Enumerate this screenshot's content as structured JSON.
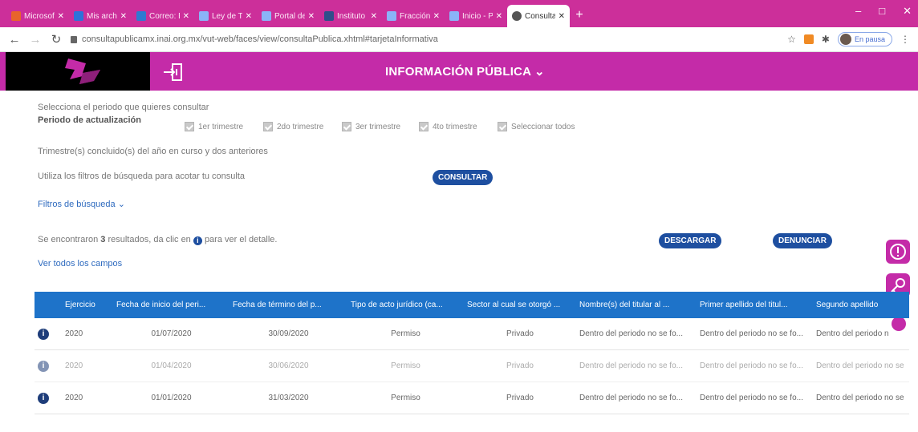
{
  "browser": {
    "tabs": [
      {
        "title": "Microsoft",
        "color": "#e8642c"
      },
      {
        "title": "Mis archivos",
        "color": "#2d72d9"
      },
      {
        "title": "Correo: Ed",
        "color": "#2f7ad1"
      },
      {
        "title": "Ley de Tra",
        "color": "#8ab4f8"
      },
      {
        "title": "Portal de T",
        "color": "#8ab4f8"
      },
      {
        "title": "Instituto d",
        "color": "#2f4f8a"
      },
      {
        "title": "Fracción I",
        "color": "#8ab4f8"
      },
      {
        "title": "Inicio - PNT",
        "color": "#8ab4f8"
      },
      {
        "title": "Consulta P",
        "color": "#555555",
        "active": true
      }
    ],
    "new_tab": "+",
    "window_controls": {
      "minimize": "–",
      "maximize": "□",
      "close": "✕"
    },
    "url": "consultapublicamx.inai.org.mx/vut-web/faces/view/consultaPublica.xhtml#tarjetaInformativa",
    "profile_label": "En pausa"
  },
  "header": {
    "title": "INFORMACIÓN PÚBLICA",
    "chevron": "⌄",
    "brand_color": "#c42ba8"
  },
  "form": {
    "select_period_hint": "Selecciona el periodo que quieres consultar",
    "period_label": "Periodo de actualización",
    "checkboxes": [
      "1er trimestre",
      "2do trimestre",
      "3er trimestre",
      "4to trimestre",
      "Seleccionar todos"
    ],
    "quarters_note": "Trimestre(s) concluido(s) del año en curso y dos anteriores",
    "filters_hint": "Utiliza los filtros de búsqueda para acotar tu consulta",
    "consult_button": "CONSULTAR",
    "filters_toggle": "Filtros de búsqueda"
  },
  "results": {
    "prefix": "Se encontraron",
    "count": "3",
    "suffix_before_icon": "resultados, da clic en",
    "suffix_after_icon": "para ver el detalle.",
    "download_button": "DESCARGAR",
    "report_button": "DENUNCIAR",
    "view_all_fields": "Ver todos los campos"
  },
  "table": {
    "headers": [
      "Ejercicio",
      "Fecha de inicio del peri...",
      "Fecha de término del p...",
      "Tipo de acto jurídico (ca...",
      "Sector al cual se otorgó ...",
      "Nombre(s) del titular al ...",
      "Primer apellido del titul...",
      "Segundo apellido"
    ],
    "rows": [
      [
        "2020",
        "01/07/2020",
        "30/09/2020",
        "Permiso",
        "Privado",
        "Dentro del periodo no se fo...",
        "Dentro del periodo no se fo...",
        "Dentro del periodo n"
      ],
      [
        "2020",
        "01/04/2020",
        "30/06/2020",
        "Permiso",
        "Privado",
        "Dentro del periodo no se fo...",
        "Dentro del periodo no se fo...",
        "Dentro del periodo no se"
      ],
      [
        "2020",
        "01/01/2020",
        "31/03/2020",
        "Permiso",
        "Privado",
        "Dentro del periodo no se fo...",
        "Dentro del periodo no se fo...",
        "Dentro del periodo no se"
      ]
    ],
    "header_color": "#1e73c9"
  }
}
